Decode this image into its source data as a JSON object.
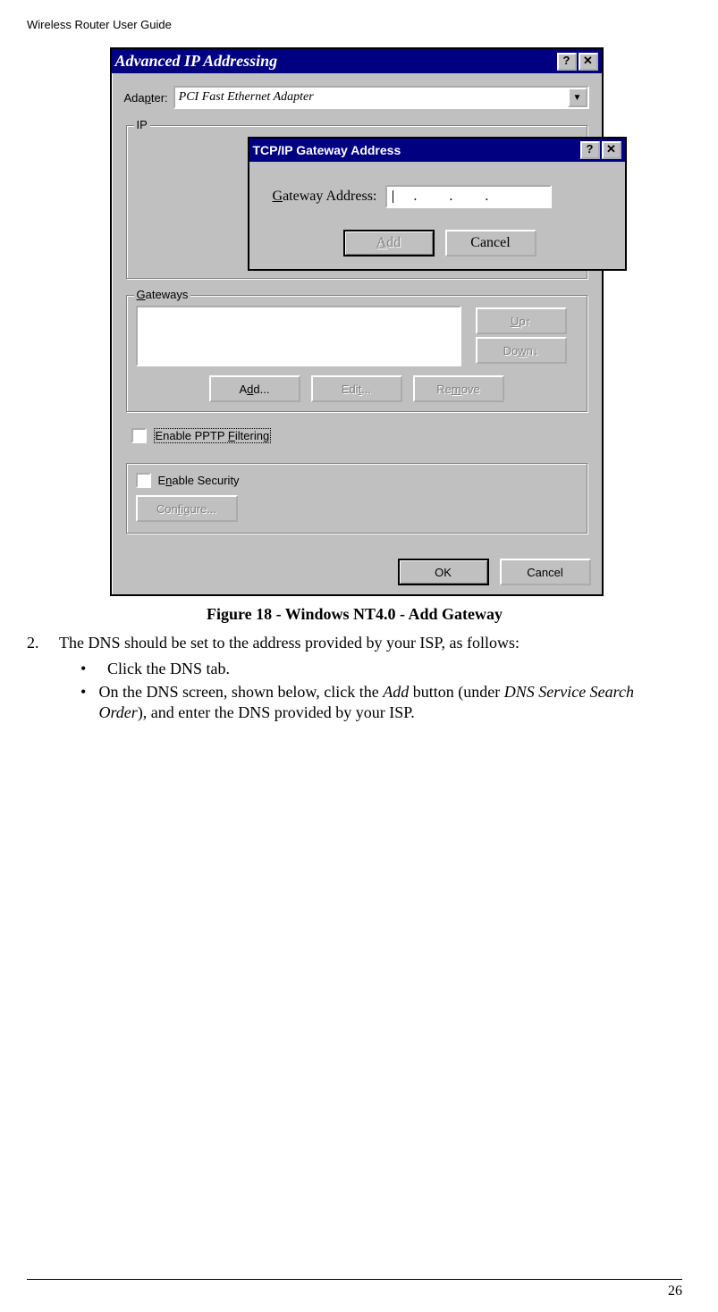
{
  "header": "Wireless Router User Guide",
  "figure_caption": "Figure 18 - Windows NT4.0 - Add Gateway",
  "step_number": "2.",
  "step_text": "The DNS should be set to the address provided by your ISP, as follows:",
  "bullets": [
    {
      "text": "Click the DNS tab."
    },
    {
      "text_pre": "On the DNS screen, shown below, click the ",
      "italic1": "Add",
      "mid": " button (under ",
      "italic2": "DNS Service Search Order",
      "post": "), and enter the DNS provided by your ISP."
    }
  ],
  "page_number": "26",
  "dialog": {
    "main_title": "Advanced IP Addressing",
    "adapter_label_pre": "Ada",
    "adapter_label_u": "p",
    "adapter_label_post": "ter:",
    "adapter_value": "PCI Fast Ethernet Adapter",
    "group_ip": "IP",
    "group_gateways_pre": "",
    "group_gateways_u": "G",
    "group_gateways_post": "ateways",
    "btn_up_pre": "",
    "btn_up_u": "U",
    "btn_up_post": "p↑",
    "btn_down_pre": "Do",
    "btn_down_u": "w",
    "btn_down_post": "n↓",
    "btn_add2_pre": "A",
    "btn_add2_u": "d",
    "btn_add2_post": "d...",
    "btn_edit_pre": "Edi",
    "btn_edit_u": "t",
    "btn_edit_post": "...",
    "btn_remove_pre": "Re",
    "btn_remove_u": "m",
    "btn_remove_post": "ove",
    "chk_pptp_pre": "Enable PPTP ",
    "chk_pptp_u": "F",
    "chk_pptp_post": "iltering",
    "chk_sec_pre": "E",
    "chk_sec_u": "n",
    "chk_sec_post": "able Security",
    "btn_configure_pre": "Con",
    "btn_configure_u": "f",
    "btn_configure_post": "igure...",
    "btn_ok": "OK",
    "btn_cancel": "Cancel",
    "help_btn": "?",
    "close_btn": "✕"
  },
  "modal": {
    "title": "TCP/IP Gateway Address",
    "label_pre": "",
    "label_u": "G",
    "label_post": "ateway Address:",
    "btn_add_pre": "",
    "btn_add_u": "A",
    "btn_add_post": "dd",
    "btn_cancel": "Cancel",
    "help_btn": "?",
    "close_btn": "✕"
  }
}
